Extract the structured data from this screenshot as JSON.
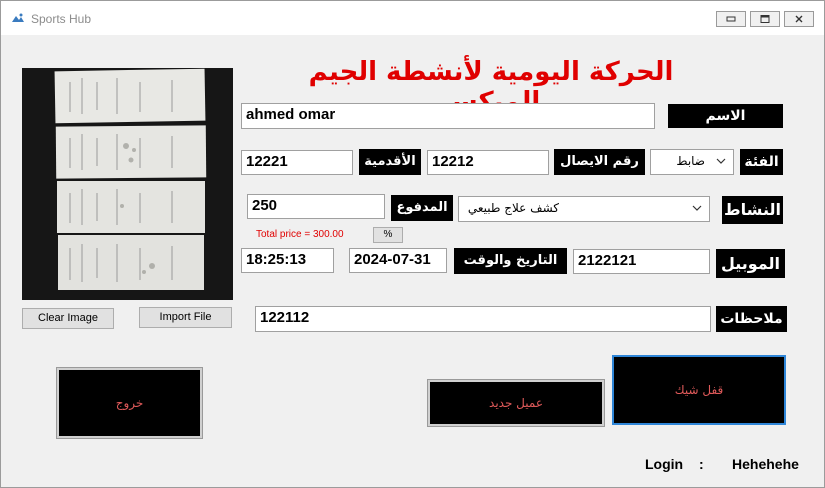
{
  "window": {
    "title": "Sports Hub",
    "controls": [
      "minimize-icon",
      "maximize-icon",
      "close-icon"
    ]
  },
  "heading": "الحركة اليومية لأنشطة الجيم الميكس",
  "image_buttons": {
    "clear": "Clear Image",
    "import": "Import File"
  },
  "form": {
    "name_label": "الاسم",
    "name_value": "ahmed omar",
    "category_label": "الفئة",
    "category_value": "ضابط",
    "receipt_label": "رقم الايصال",
    "receipt_value": "12212",
    "seniority_label": "الأقدمية",
    "seniority_value": "12221",
    "activity_label": "النشاط",
    "activity_value": "كشف علاج طبيعي",
    "paid_label": "المدفوع",
    "paid_value": "250",
    "total_price": "Total price = 300.00",
    "percent_button": "%",
    "mobile_label": "الموبيل",
    "mobile_value": "2122121",
    "datetime_label": "التاريخ والوقت",
    "date_value": "2024-07-31",
    "time_value": "18:25:13",
    "notes_label": "ملاحظات",
    "notes_value": "122112"
  },
  "actions": {
    "exit": "خروج",
    "new_client": "عميل جديد",
    "lock_check": "قفل شيك"
  },
  "login": {
    "label": "Login",
    "separator": ":",
    "user": "Hehehehe"
  },
  "colors": {
    "heading": "#e00000",
    "label_bg": "#000000",
    "action_text": "#e05a5a",
    "price_note": "#e00000"
  }
}
